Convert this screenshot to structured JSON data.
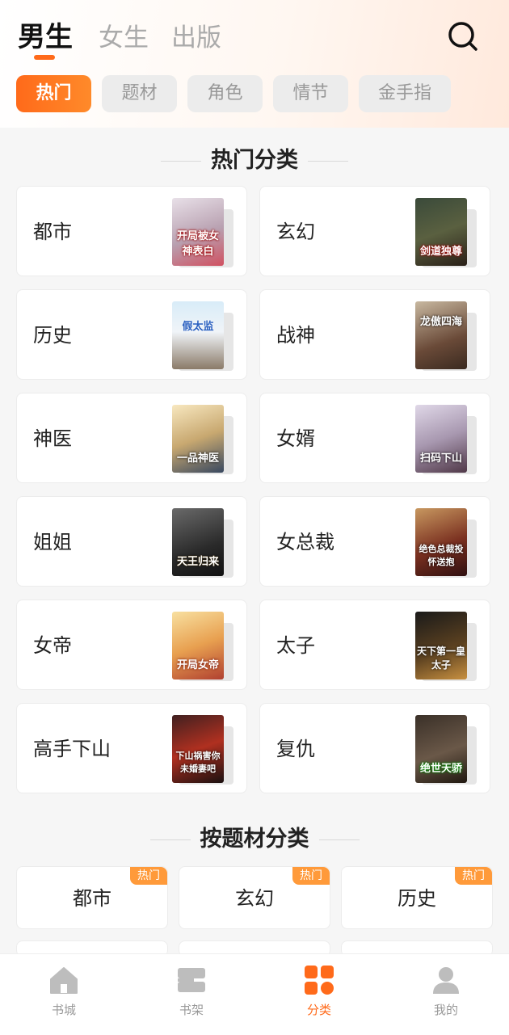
{
  "header": {
    "tabs": [
      {
        "label": "男生",
        "active": true
      },
      {
        "label": "女生",
        "active": false
      },
      {
        "label": "出版",
        "active": false
      }
    ],
    "search_icon": "search-icon"
  },
  "chips": [
    {
      "label": "热门",
      "active": true
    },
    {
      "label": "题材",
      "active": false
    },
    {
      "label": "角色",
      "active": false
    },
    {
      "label": "情节",
      "active": false
    },
    {
      "label": "金手指",
      "active": false
    }
  ],
  "hot_section": {
    "title": "热门分类",
    "cards": [
      {
        "label": "都市",
        "cover_text": "开局被女神表白"
      },
      {
        "label": "玄幻",
        "cover_text": "剑道独尊"
      },
      {
        "label": "历史",
        "cover_text": "假太监"
      },
      {
        "label": "战神",
        "cover_text": "龙傲四海"
      },
      {
        "label": "神医",
        "cover_text": "一品神医"
      },
      {
        "label": "女婿",
        "cover_text": "扫码下山"
      },
      {
        "label": "姐姐",
        "cover_text": "天王归来"
      },
      {
        "label": "女总裁",
        "cover_text": "绝色总裁投怀送抱"
      },
      {
        "label": "女帝",
        "cover_text": "开局女帝"
      },
      {
        "label": "太子",
        "cover_text": "天下第一皇太子"
      },
      {
        "label": "高手下山",
        "cover_text": "下山祸害你未婚妻吧"
      },
      {
        "label": "复仇",
        "cover_text": "绝世天骄"
      }
    ]
  },
  "topic_section": {
    "title": "按题材分类",
    "badge": "热门",
    "items": [
      {
        "label": "都市",
        "hot": true
      },
      {
        "label": "玄幻",
        "hot": true
      },
      {
        "label": "历史",
        "hot": true
      }
    ]
  },
  "bottom_nav": [
    {
      "label": "书城",
      "icon": "home-icon",
      "active": false
    },
    {
      "label": "书架",
      "icon": "bookshelf-icon",
      "active": false
    },
    {
      "label": "分类",
      "icon": "category-icon",
      "active": true
    },
    {
      "label": "我的",
      "icon": "profile-icon",
      "active": false
    }
  ],
  "colors": {
    "accent": "#ff6a1a",
    "badge": "#ff9a3a",
    "background": "#f6f6f6"
  }
}
